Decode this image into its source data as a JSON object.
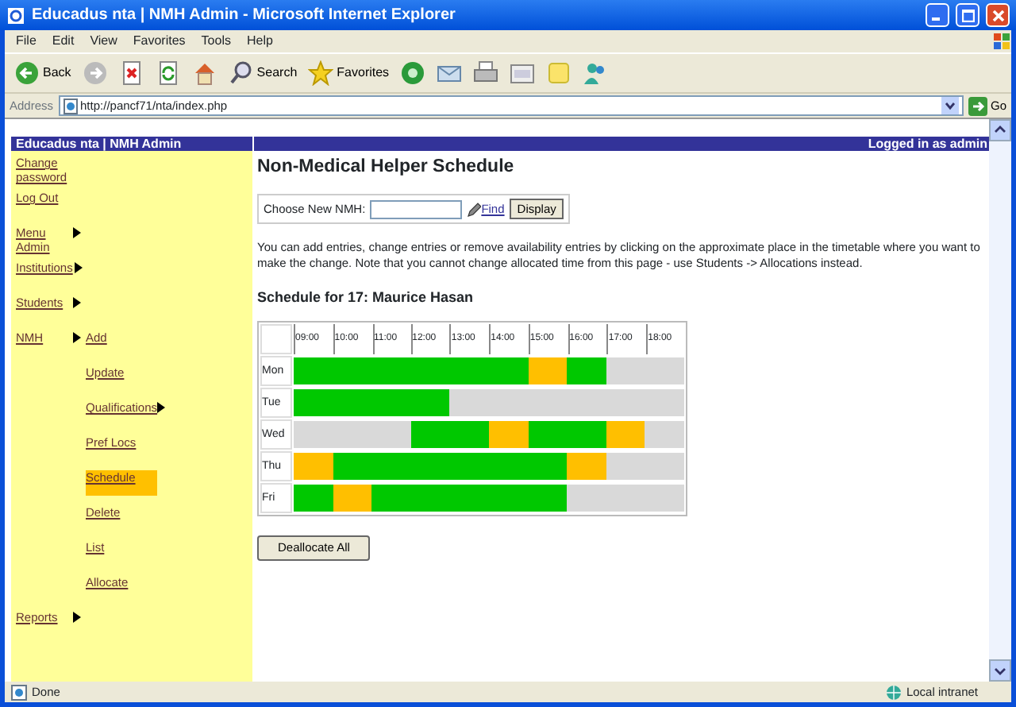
{
  "window": {
    "title": "Educadus nta | NMH Admin - Microsoft Internet Explorer"
  },
  "menu": [
    "File",
    "Edit",
    "View",
    "Favorites",
    "Tools",
    "Help"
  ],
  "toolbar": [
    {
      "kind": "back",
      "label": "Back"
    },
    {
      "kind": "forward"
    },
    {
      "kind": "stop"
    },
    {
      "kind": "refresh"
    },
    {
      "kind": "home"
    },
    {
      "kind": "search",
      "label": "Search"
    },
    {
      "kind": "favorites",
      "label": "Favorites"
    },
    {
      "kind": "media"
    },
    {
      "kind": "mail"
    },
    {
      "kind": "print"
    },
    {
      "kind": "edit"
    },
    {
      "kind": "note"
    },
    {
      "kind": "messenger"
    }
  ],
  "address": {
    "label": "Address",
    "value": "http://pancf71/nta/index.php",
    "go": "Go"
  },
  "page": {
    "site_title": "Educadus nta | NMH Admin",
    "login_status": "Logged in as admin",
    "sidebar": {
      "items": [
        {
          "label": "Change password",
          "has_submenu": false,
          "selected": false
        },
        {
          "label": "Log Out",
          "has_submenu": false,
          "selected": false
        },
        {
          "label": "Menu Admin",
          "has_submenu": true,
          "selected": false
        },
        {
          "label": "Institutions",
          "has_submenu": true,
          "selected": false
        },
        {
          "label": "Students",
          "has_submenu": true,
          "selected": false
        },
        {
          "label": "NMH",
          "has_submenu": true,
          "selected": false,
          "children": [
            {
              "label": "Add",
              "has_submenu": false,
              "selected": false
            },
            {
              "label": "Update",
              "has_submenu": false,
              "selected": false
            },
            {
              "label": "Qualifications",
              "has_submenu": true,
              "selected": false
            },
            {
              "label": "Pref Locs",
              "has_submenu": false,
              "selected": false
            },
            {
              "label": "Schedule",
              "has_submenu": false,
              "selected": true
            },
            {
              "label": "Delete",
              "has_submenu": false,
              "selected": false
            },
            {
              "label": "List",
              "has_submenu": false,
              "selected": false
            },
            {
              "label": "Allocate",
              "has_submenu": false,
              "selected": false
            }
          ]
        },
        {
          "label": "Reports",
          "has_submenu": true,
          "selected": false
        }
      ]
    },
    "heading": "Non-Medical Helper Schedule",
    "chooser": {
      "label": "Choose New NMH:",
      "find": "Find",
      "button": "Display"
    },
    "instructions": "You can add entries, change entries or remove availability entries by clicking on the approximate place in the timetable where you want to make the change. Note that you cannot change allocated time from this page - use Students -> Allocations instead.",
    "schedule_title": "Schedule for 17: Maurice Hasan",
    "timetable": {
      "hours": [
        "09:00",
        "10:00",
        "11:00",
        "12:00",
        "13:00",
        "14:00",
        "15:00",
        "16:00",
        "17:00",
        "18:00"
      ],
      "rows": [
        {
          "day": "Mon",
          "slots": [
            {
              "kind": "available"
            },
            {
              "kind": "available"
            },
            {
              "kind": "available"
            },
            {
              "kind": "available"
            },
            {
              "kind": "available"
            },
            {
              "kind": "available"
            },
            {
              "kind": "allocated"
            },
            {
              "kind": "available"
            },
            {
              "kind": "free"
            },
            {
              "kind": "free"
            }
          ]
        },
        {
          "day": "Tue",
          "slots": [
            {
              "kind": "available"
            },
            {
              "kind": "available"
            },
            {
              "kind": "available"
            },
            {
              "kind": "available"
            },
            {
              "kind": "free"
            },
            {
              "kind": "free"
            },
            {
              "kind": "free"
            },
            {
              "kind": "free"
            },
            {
              "kind": "free"
            },
            {
              "kind": "free"
            }
          ]
        },
        {
          "day": "Wed",
          "slots": [
            {
              "kind": "free"
            },
            {
              "kind": "free"
            },
            {
              "kind": "free"
            },
            {
              "kind": "available"
            },
            {
              "kind": "available"
            },
            {
              "kind": "allocated"
            },
            {
              "kind": "available"
            },
            {
              "kind": "available"
            },
            {
              "kind": "allocated"
            },
            {
              "kind": "free"
            }
          ]
        },
        {
          "day": "Thu",
          "slots": [
            {
              "kind": "allocated"
            },
            {
              "kind": "available"
            },
            {
              "kind": "available"
            },
            {
              "kind": "available"
            },
            {
              "kind": "available"
            },
            {
              "kind": "available"
            },
            {
              "kind": "available"
            },
            {
              "kind": "allocated"
            },
            {
              "kind": "free"
            },
            {
              "kind": "free"
            }
          ]
        },
        {
          "day": "Fri",
          "slots": [
            {
              "kind": "available"
            },
            {
              "kind": "allocated"
            },
            {
              "kind": "available"
            },
            {
              "kind": "available"
            },
            {
              "kind": "available"
            },
            {
              "kind": "available"
            },
            {
              "kind": "available"
            },
            {
              "kind": "free"
            },
            {
              "kind": "free"
            },
            {
              "kind": "free"
            }
          ]
        }
      ]
    },
    "deallocate": "Deallocate All"
  },
  "status_bar": {
    "text": "Done",
    "zone": "Local intranet"
  }
}
